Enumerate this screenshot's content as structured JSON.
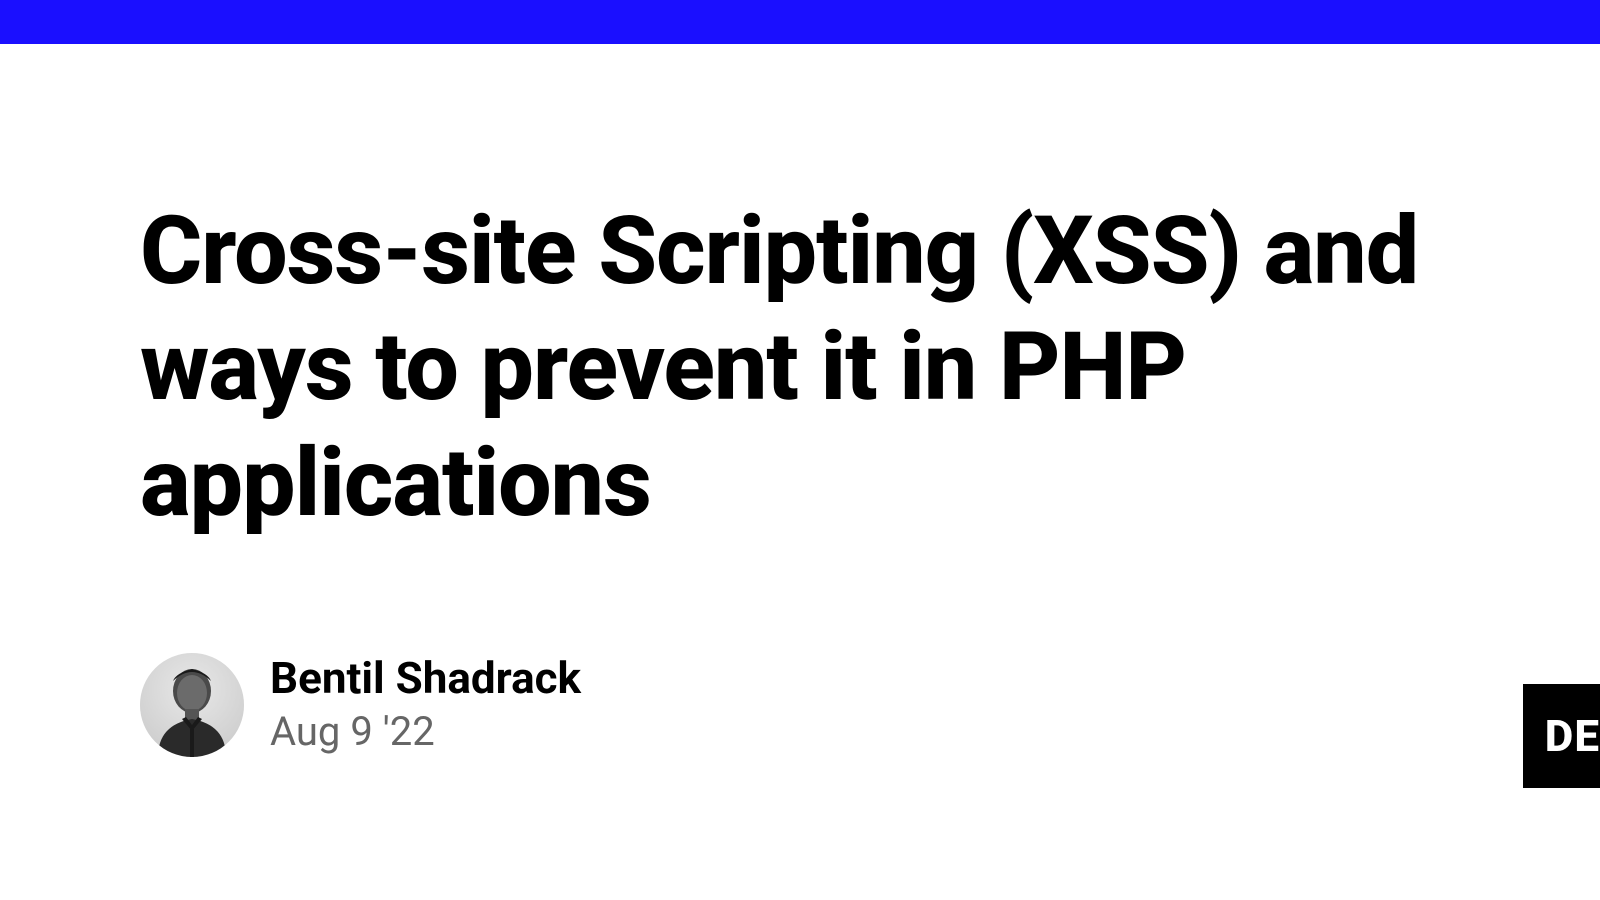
{
  "header": {
    "bar_color": "#1a0fff"
  },
  "article": {
    "title": "Cross-site Scripting (XSS) and ways to prevent it in PHP applications"
  },
  "author": {
    "name": "Bentil Shadrack",
    "date": "Aug 9 '22"
  },
  "badge": {
    "text": "DE"
  }
}
